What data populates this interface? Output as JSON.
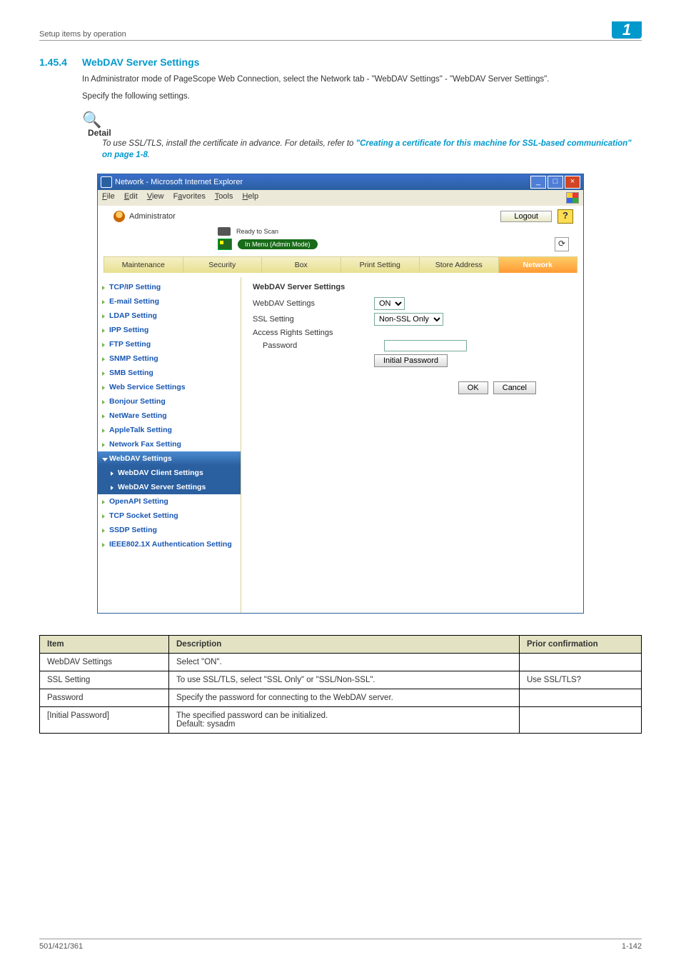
{
  "header": {
    "breadcrumb": "Setup items by operation",
    "chapter": "1"
  },
  "section": {
    "number": "1.45.4",
    "heading": "WebDAV Server Settings",
    "para1": "In Administrator mode of PageScope Web Connection, select the Network tab - \"WebDAV Settings\" - \"WebDAV Server Settings\".",
    "para2": "Specify the following settings.",
    "detail_label": "Detail",
    "detail_text_pre": "To use SSL/TLS, install the certificate in advance. For details, refer to ",
    "detail_link": "\"Creating a certificate for this machine for SSL-based communication\" on page 1-8",
    "detail_text_post": "."
  },
  "browser": {
    "title": "Network - Microsoft Internet Explorer",
    "menus": [
      "File",
      "Edit",
      "View",
      "Favorites",
      "Tools",
      "Help"
    ],
    "admin_label": "Administrator",
    "logout": "Logout",
    "help": "?",
    "status_ready": "Ready to Scan",
    "status_mode": "In Menu (Admin Mode)",
    "refresh_glyph": "⟳",
    "tabs": [
      "Maintenance",
      "Security",
      "Box",
      "Print Setting",
      "Store Address",
      "Network"
    ],
    "sidebar": [
      "TCP/IP Setting",
      "E-mail Setting",
      "LDAP Setting",
      "IPP Setting",
      "FTP Setting",
      "SNMP Setting",
      "SMB Setting",
      "Web Service Settings",
      "Bonjour Setting",
      "NetWare Setting",
      "AppleTalk Setting",
      "Network Fax Setting"
    ],
    "group_label": "WebDAV Settings",
    "subitems": [
      "WebDAV Client Settings",
      "WebDAV Server Settings"
    ],
    "sidebar_after": [
      "OpenAPI Setting",
      "TCP Socket Setting",
      "SSDP Setting",
      "IEEE802.1X Authentication Setting"
    ],
    "pane": {
      "title": "WebDAV Server Settings",
      "rows": [
        {
          "label": "WebDAV Settings",
          "value": "ON",
          "type": "select"
        },
        {
          "label": "SSL Setting",
          "value": "Non-SSL Only",
          "type": "select"
        },
        {
          "label": "Access Rights Settings",
          "type": "none"
        },
        {
          "label": "Password",
          "value": "",
          "type": "text",
          "indent": true
        }
      ],
      "initial_pw": "Initial Password",
      "ok": "OK",
      "cancel": "Cancel"
    }
  },
  "table": {
    "headers": [
      "Item",
      "Description",
      "Prior confirmation"
    ],
    "rows": [
      {
        "item": "WebDAV Settings",
        "desc": "Select \"ON\".",
        "prior": ""
      },
      {
        "item": "SSL Setting",
        "desc": "To use SSL/TLS, select \"SSL Only\" or \"SSL/Non-SSL\".",
        "prior": "Use SSL/TLS?"
      },
      {
        "item": "Password",
        "desc": "Specify the password for connecting to the WebDAV server.",
        "prior": ""
      },
      {
        "item": "[Initial Password]",
        "desc": "The specified password can be initialized.\nDefault: sysadm",
        "prior": ""
      }
    ]
  },
  "footer": {
    "left": "501/421/361",
    "right": "1-142"
  }
}
